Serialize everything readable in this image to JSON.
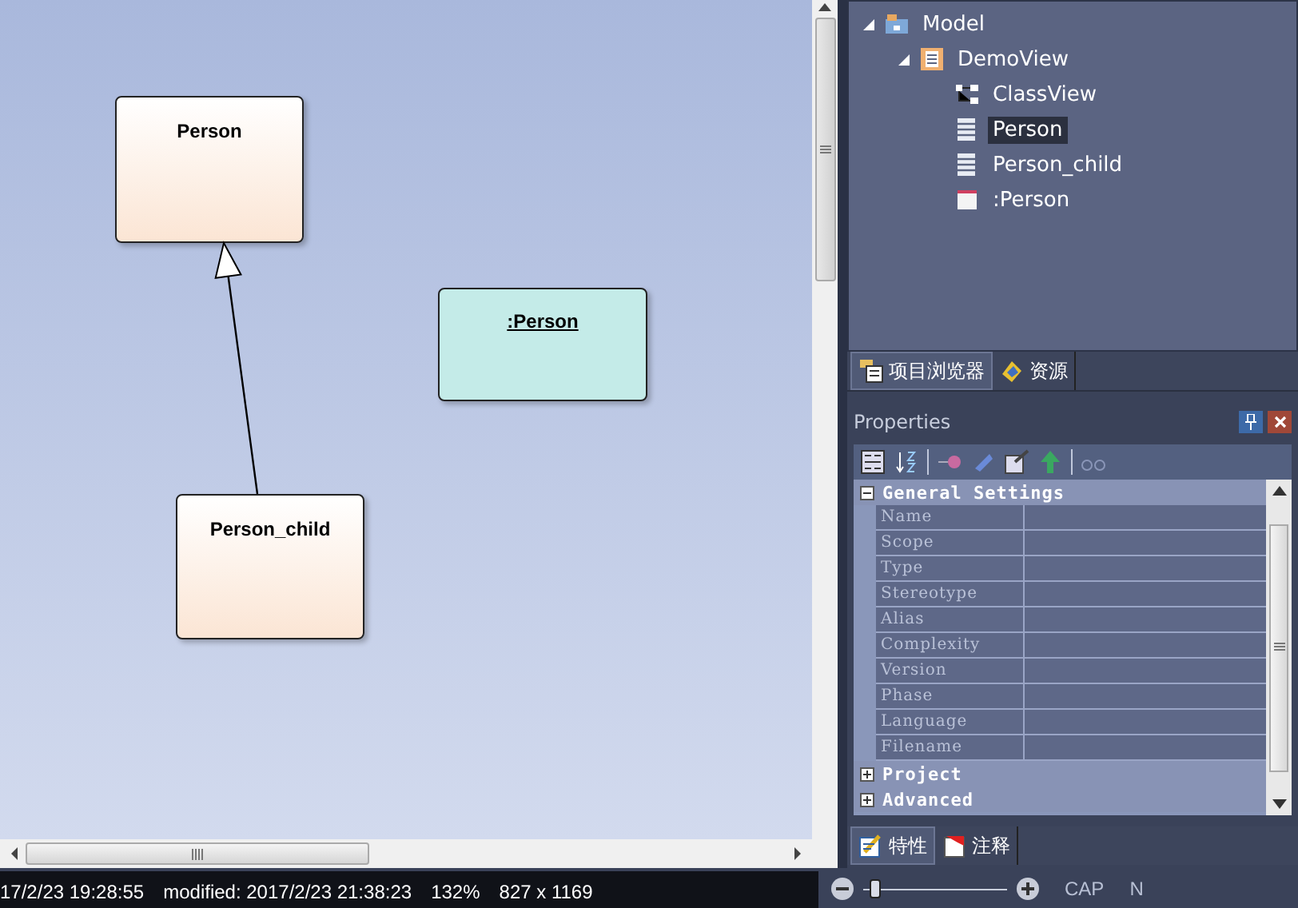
{
  "diagram": {
    "nodes": [
      {
        "kind": "class",
        "label": "Person"
      },
      {
        "kind": "object",
        "label": ":Person"
      },
      {
        "kind": "class",
        "label": "Person_child"
      }
    ],
    "links": [
      {
        "kind": "generalization"
      }
    ]
  },
  "project_browser": {
    "tree": [
      {
        "kind": "model",
        "label": "Model",
        "expanded": true,
        "selected": false,
        "children": [
          {
            "kind": "view",
            "label": "DemoView",
            "expanded": true,
            "selected": false,
            "children": [
              {
                "kind": "diagram",
                "label": "ClassView",
                "selected": false
              },
              {
                "kind": "class",
                "label": "Person",
                "selected": true
              },
              {
                "kind": "class",
                "label": "Person_child",
                "selected": false
              },
              {
                "kind": "object",
                "label": ":Person",
                "selected": false
              }
            ]
          }
        ]
      }
    ],
    "tabs": [
      {
        "kind": "browser",
        "label": "项目浏览器",
        "selected": true
      },
      {
        "kind": "resources",
        "label": "资源",
        "selected": false
      }
    ]
  },
  "properties": {
    "title": "Properties",
    "groups": [
      {
        "label": "General Settings",
        "expanded": true,
        "rows": [
          "Name",
          "Scope",
          "Type",
          "Stereotype",
          "Alias",
          "Complexity",
          "Version",
          "Phase",
          "Language",
          "Filename"
        ]
      },
      {
        "label": "Project",
        "expanded": false
      },
      {
        "label": "Advanced",
        "expanded": false
      }
    ],
    "tabs": [
      {
        "kind": "properties",
        "label": "特性",
        "selected": true
      },
      {
        "kind": "notes",
        "label": "注释",
        "selected": false
      }
    ]
  },
  "status_bar": {
    "created": "17/2/23 19:28:55",
    "modified": "modified: 2017/2/23 21:38:23",
    "zoom": "132%",
    "size": "827 x 1169",
    "zoom_slider": {
      "level": 0.05
    },
    "indicators": [
      "CAP",
      "N"
    ]
  }
}
